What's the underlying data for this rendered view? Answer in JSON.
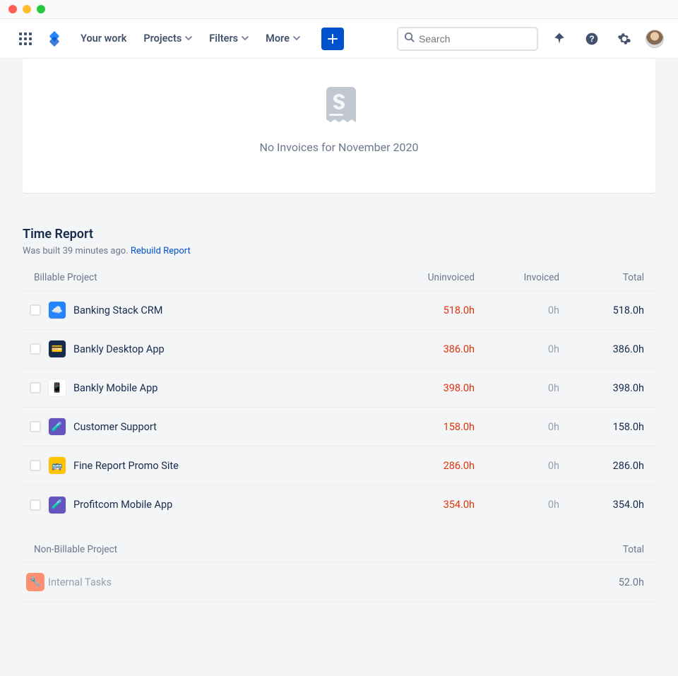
{
  "nav": {
    "your_work": "Your work",
    "projects": "Projects",
    "filters": "Filters",
    "more": "More",
    "search_placeholder": "Search"
  },
  "empty_state": {
    "message": "No Invoices for November 2020"
  },
  "time_report": {
    "title": "Time Report",
    "built_text": "Was built 39 minutes ago.",
    "rebuild_link": "Rebuild Report",
    "columns": {
      "project": "Billable Project",
      "uninvoiced": "Uninvoiced",
      "invoiced": "Invoiced",
      "total": "Total"
    },
    "rows": [
      {
        "name": "Banking Stack CRM",
        "uninvoiced": "518.0h",
        "invoiced": "0h",
        "total": "518.0h",
        "icon_bg": "#2684ff",
        "icon_glyph": "☁️"
      },
      {
        "name": "Bankly Desktop App",
        "uninvoiced": "386.0h",
        "invoiced": "0h",
        "total": "386.0h",
        "icon_bg": "#172b4d",
        "icon_glyph": "💳"
      },
      {
        "name": "Bankly Mobile App",
        "uninvoiced": "398.0h",
        "invoiced": "0h",
        "total": "398.0h",
        "icon_bg": "#ffffff",
        "icon_glyph": "📱"
      },
      {
        "name": "Customer Support",
        "uninvoiced": "158.0h",
        "invoiced": "0h",
        "total": "158.0h",
        "icon_bg": "#6554c0",
        "icon_glyph": "🧪"
      },
      {
        "name": "Fine Report Promo Site",
        "uninvoiced": "286.0h",
        "invoiced": "0h",
        "total": "286.0h",
        "icon_bg": "#ffc400",
        "icon_glyph": "🚌"
      },
      {
        "name": "Profitcom Mobile App",
        "uninvoiced": "354.0h",
        "invoiced": "0h",
        "total": "354.0h",
        "icon_bg": "#6554c0",
        "icon_glyph": "🧪"
      }
    ],
    "nonbillable": {
      "header_project": "Non-Billable Project",
      "header_total": "Total",
      "rows": [
        {
          "name": "Internal Tasks",
          "total": "52.0h",
          "icon_bg": "#ff8f73",
          "icon_glyph": "🔧"
        }
      ]
    }
  }
}
